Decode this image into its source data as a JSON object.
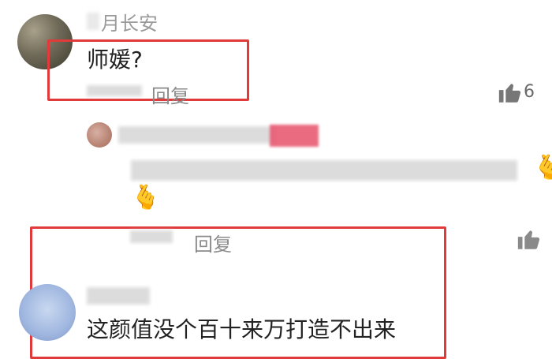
{
  "comments": [
    {
      "name": "月长安",
      "text": "师媛?",
      "reply": "回复",
      "likes": "6"
    },
    {
      "reply": "回复",
      "emoji": "🫰"
    },
    {
      "text": "这颜值没个百十来万打造不出来"
    }
  ],
  "colors": {
    "highlight": "#e03a3a"
  }
}
